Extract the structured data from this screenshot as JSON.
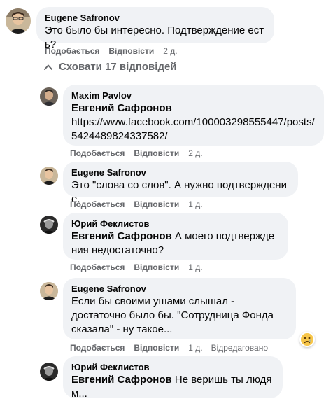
{
  "comments": [
    {
      "author": "Eugene Safronov",
      "text": "Это было бы интересно. Подтверждение есть?",
      "like": "Подобається",
      "reply": "Відповісти",
      "time": "2 д."
    },
    {
      "author": "Maxim Pavlov",
      "mention": "Евгений Сафронов",
      "text": "https://www.facebook.com/100003298555447/posts/5424489824337582/",
      "like": "Подобається",
      "reply": "Відповісти",
      "time": "2 д."
    },
    {
      "author": "Eugene Safronov",
      "text": "Это \"слова со слов\". А нужно подтверждение.",
      "like": "Подобається",
      "reply": "Відповісти",
      "time": "1 д."
    },
    {
      "author": "Юрий Феклистов",
      "mention": "Евгений Сафронов",
      "text": " А моего подтверждения недостаточно?",
      "like": "Подобається",
      "reply": "Відповісти",
      "time": "1 д."
    },
    {
      "author": "Eugene Safronov",
      "text": "Если бы своими ушами слышал - достаточно было бы. \"Сотрудница Фонда сказала\" - ну такое...",
      "like": "Подобається",
      "reply": "Відповісти",
      "time": "1 д.",
      "edited": "Відредаговано",
      "reaction": "sad-reaction-icon"
    },
    {
      "author": "Юрий Феклистов",
      "mention": "Евгений Сафронов",
      "text": " Не веришь ты людям..."
    }
  ],
  "hide_replies": "Сховати 17 відповідей"
}
